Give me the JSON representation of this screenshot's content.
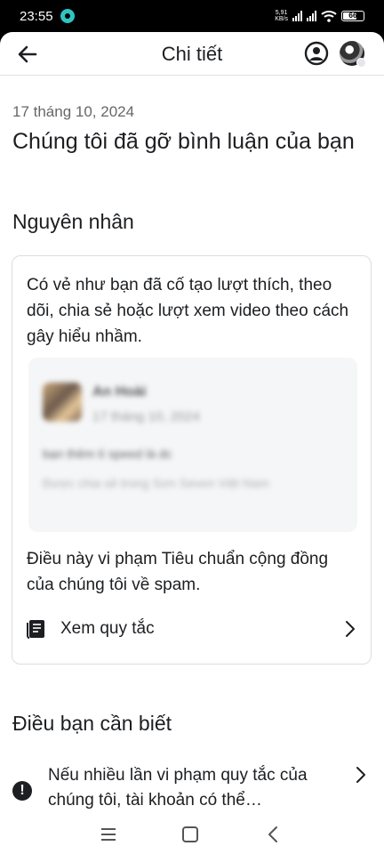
{
  "status_bar": {
    "time": "23:55",
    "net_speed_value": "5,91",
    "net_speed_unit": "KB/s",
    "battery": "66"
  },
  "header": {
    "title": "Chi tiết",
    "back_icon": "arrow-left-icon",
    "account_icon": "account-circle-icon"
  },
  "content": {
    "date": "17 tháng 10, 2024",
    "headline": "Chúng tôi đã gỡ bình luận của bạn",
    "reason_heading": "Nguyên nhân",
    "reason_text": "Có vẻ như bạn đã cố tạo lượt thích, theo dõi, chia sẻ hoặc lượt xem video theo cách gây hiểu nhầm.",
    "preview": {
      "name": "An Hoài",
      "date": "17 tháng 10, 2024",
      "comment": "bạn thêm tí speed là dc",
      "meta": "Được chia sẻ trong Sơn Seven Việt Nam"
    },
    "violation_text": "Điều này vi phạm Tiêu chuẩn cộng đồng của chúng tôi về spam.",
    "rules_link": "Xem quy tắc",
    "know_heading": "Điều bạn cần biết",
    "notice_text": "Nếu nhiều lần vi phạm quy tắc của chúng tôi, tài khoản có thể…",
    "notice_icon_glyph": "!"
  },
  "colors": {
    "primary_text": "#1c1e21",
    "secondary_text": "#65676b",
    "border": "#dadde1"
  }
}
